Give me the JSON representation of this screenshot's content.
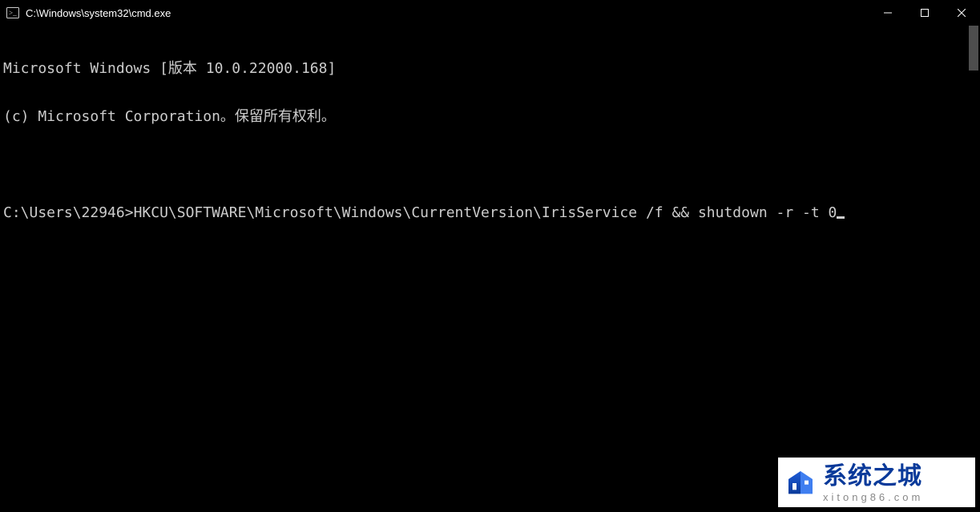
{
  "window": {
    "title": "C:\\Windows\\system32\\cmd.exe"
  },
  "terminal": {
    "line1": "Microsoft Windows [版本 10.0.22000.168]",
    "line2": "(c) Microsoft Corporation。保留所有权利。",
    "prompt": "C:\\Users\\22946>",
    "command": "HKCU\\SOFTWARE\\Microsoft\\Windows\\CurrentVersion\\IrisService /f && shutdown -r -t 0"
  },
  "watermark": {
    "brand_cn": "系统之城",
    "url": "xitong86.com"
  },
  "colors": {
    "bg": "#000000",
    "fg": "#cccccc",
    "brand_blue": "#0a3a9a"
  }
}
